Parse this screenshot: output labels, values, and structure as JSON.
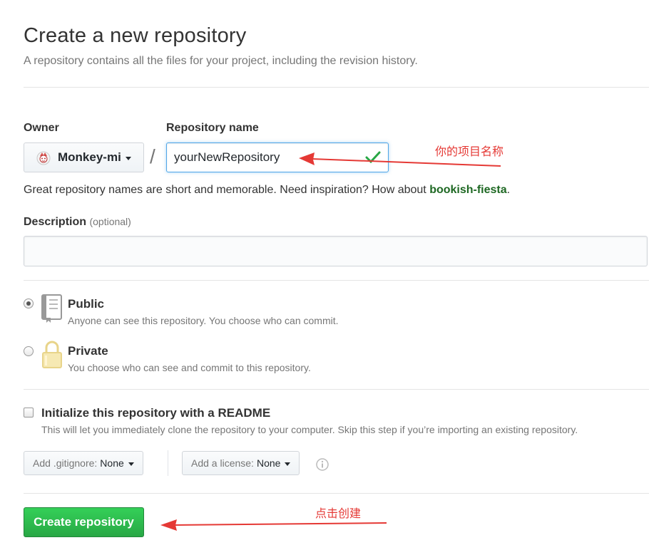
{
  "header": {
    "title": "Create a new repository",
    "subtitle": "A repository contains all the files for your project, including the revision history."
  },
  "owner": {
    "label": "Owner",
    "value": "Monkey-mi"
  },
  "separator": "/",
  "repo": {
    "label": "Repository name",
    "value": "yourNewRepository",
    "valid": true
  },
  "hint": {
    "text": "Great repository names are short and memorable. Need inspiration? How about ",
    "suggestion": "bookish-fiesta",
    "end": "."
  },
  "description": {
    "label": "Description",
    "optional": "(optional)",
    "value": ""
  },
  "visibility": {
    "selected": "public",
    "public": {
      "title": "Public",
      "desc": "Anyone can see this repository. You choose who can commit."
    },
    "private": {
      "title": "Private",
      "desc": "You choose who can see and commit to this repository."
    }
  },
  "readme": {
    "checked": false,
    "title": "Initialize this repository with a README",
    "desc": "This will let you immediately clone the repository to your computer. Skip this step if you’re importing an existing repository."
  },
  "gitignore": {
    "prefix": "Add .gitignore:",
    "value": "None"
  },
  "license": {
    "prefix": "Add a license:",
    "value": "None"
  },
  "submit": {
    "label": "Create repository"
  },
  "annotations": {
    "repo_name": "你的项目名称",
    "create": "点击创建",
    "color": "#e53935"
  },
  "colors": {
    "accent_blue": "#51a7e8",
    "button_green": "#28a745",
    "check_green": "#28a745",
    "suggestion_green": "#1e6823"
  }
}
